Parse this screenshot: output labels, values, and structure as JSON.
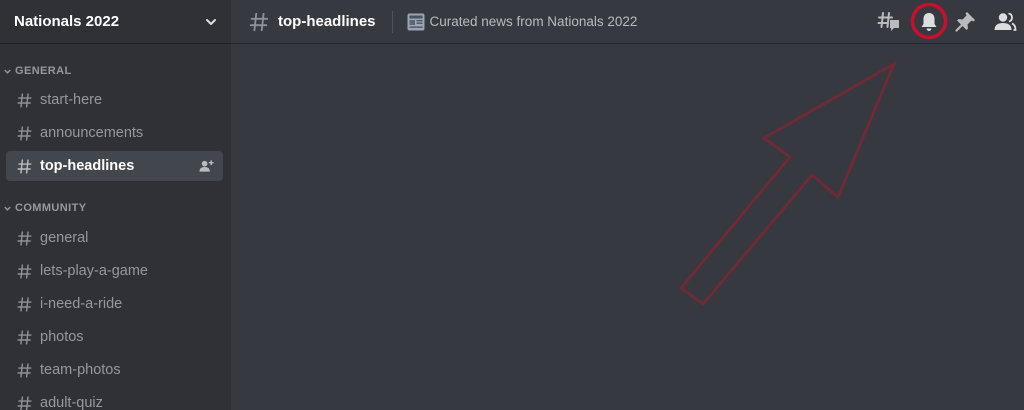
{
  "server": {
    "name": "Nationals 2022",
    "chevron_icon": "chevron-down-icon"
  },
  "categories": [
    {
      "label": "GENERAL",
      "channels": [
        {
          "name": "start-here",
          "active": false
        },
        {
          "name": "announcements",
          "active": false
        },
        {
          "name": "top-headlines",
          "active": true,
          "icon_right": "invite-member-icon"
        }
      ]
    },
    {
      "label": "COMMUNITY",
      "channels": [
        {
          "name": "general",
          "active": false
        },
        {
          "name": "lets-play-a-game",
          "active": false
        },
        {
          "name": "i-need-a-ride",
          "active": false
        },
        {
          "name": "photos",
          "active": false
        },
        {
          "name": "team-photos",
          "active": false
        },
        {
          "name": "adult-quiz",
          "active": false
        }
      ]
    }
  ],
  "header": {
    "channel_name": "top-headlines",
    "topic_icon": "newspaper-icon",
    "topic": "Curated news from Nationals 2022",
    "toolbar_icons": [
      "threads-icon",
      "notification-bell-icon",
      "pin-icon",
      "member-list-icon"
    ]
  },
  "annotation": {
    "highlighted_icon": "notification-bell-icon",
    "circle_color": "#c8102e",
    "arrow_color": "#6e2a35"
  },
  "colors": {
    "sidebar_bg": "#2f3136",
    "main_bg": "#36393f",
    "active_channel_bg": "#42464d",
    "muted_text": "#96989d",
    "white": "#ffffff"
  }
}
